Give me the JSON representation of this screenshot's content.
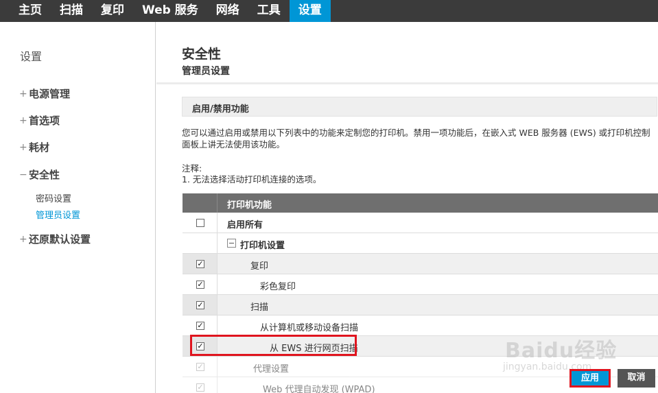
{
  "nav": {
    "tabs": [
      {
        "label": "主页"
      },
      {
        "label": "扫描"
      },
      {
        "label": "复印"
      },
      {
        "label": "Web 服务"
      },
      {
        "label": "网络"
      },
      {
        "label": "工具"
      },
      {
        "label": "设置",
        "active": true
      }
    ]
  },
  "sidebar": {
    "title": "设置",
    "items": [
      {
        "sign": "+",
        "label": "电源管理"
      },
      {
        "sign": "+",
        "label": "首选项"
      },
      {
        "sign": "+",
        "label": "耗材"
      },
      {
        "sign": "−",
        "label": "安全性"
      },
      {
        "sign": "+",
        "label": "还原默认设置"
      }
    ],
    "subitems": [
      {
        "label": "密码设置"
      },
      {
        "label": "管理员设置",
        "active": true
      }
    ]
  },
  "main": {
    "title": "安全性",
    "subtitle": "管理员设置",
    "section_title": "启用/禁用功能",
    "description": "您可以通过启用或禁用以下列表中的功能来定制您的打印机。禁用一项功能后，在嵌入式 WEB 服务器 (EWS) 或打印机控制面板上讲无法使用该功能。",
    "note_label": "注释:",
    "note_item": "1. 无法选择活动打印机连接的选项。"
  },
  "table": {
    "header": "打印机功能",
    "rows": [
      {
        "label": "启用所有",
        "checked": false
      },
      {
        "label": "打印机设置",
        "group": true
      },
      {
        "label": "复印",
        "checked": true
      },
      {
        "label": "彩色复印",
        "checked": true
      },
      {
        "label": "扫描",
        "checked": true
      },
      {
        "label": "从计算机或移动设备扫描",
        "checked": true
      },
      {
        "label": "从 EWS 进行网页扫描",
        "checked": true
      },
      {
        "label": "代理设置",
        "checked": true
      },
      {
        "label": "Web 代理自动发现 (WPAD)",
        "checked": true
      }
    ],
    "check_glyph": "✓"
  },
  "buttons": {
    "apply": "应用",
    "cancel": "取消"
  },
  "watermark": {
    "main": "Baidu经验",
    "sub": "jingyan.baidu.com"
  },
  "colors": {
    "accent": "#0096d6",
    "highlight": "#e0141e",
    "nav_bg": "#3b3b3b"
  }
}
